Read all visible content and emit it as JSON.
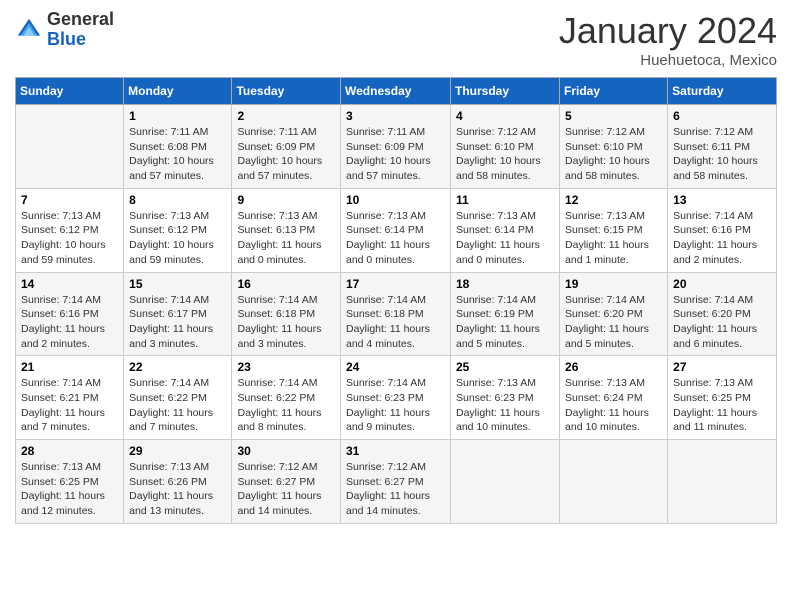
{
  "header": {
    "logo_line1": "General",
    "logo_line2": "Blue",
    "month_title": "January 2024",
    "location": "Huehuetoca, Mexico"
  },
  "days_of_week": [
    "Sunday",
    "Monday",
    "Tuesday",
    "Wednesday",
    "Thursday",
    "Friday",
    "Saturday"
  ],
  "weeks": [
    [
      {
        "day": "",
        "info": ""
      },
      {
        "day": "1",
        "info": "Sunrise: 7:11 AM\nSunset: 6:08 PM\nDaylight: 10 hours\nand 57 minutes."
      },
      {
        "day": "2",
        "info": "Sunrise: 7:11 AM\nSunset: 6:09 PM\nDaylight: 10 hours\nand 57 minutes."
      },
      {
        "day": "3",
        "info": "Sunrise: 7:11 AM\nSunset: 6:09 PM\nDaylight: 10 hours\nand 57 minutes."
      },
      {
        "day": "4",
        "info": "Sunrise: 7:12 AM\nSunset: 6:10 PM\nDaylight: 10 hours\nand 58 minutes."
      },
      {
        "day": "5",
        "info": "Sunrise: 7:12 AM\nSunset: 6:10 PM\nDaylight: 10 hours\nand 58 minutes."
      },
      {
        "day": "6",
        "info": "Sunrise: 7:12 AM\nSunset: 6:11 PM\nDaylight: 10 hours\nand 58 minutes."
      }
    ],
    [
      {
        "day": "7",
        "info": "Sunrise: 7:13 AM\nSunset: 6:12 PM\nDaylight: 10 hours\nand 59 minutes."
      },
      {
        "day": "8",
        "info": "Sunrise: 7:13 AM\nSunset: 6:12 PM\nDaylight: 10 hours\nand 59 minutes."
      },
      {
        "day": "9",
        "info": "Sunrise: 7:13 AM\nSunset: 6:13 PM\nDaylight: 11 hours\nand 0 minutes."
      },
      {
        "day": "10",
        "info": "Sunrise: 7:13 AM\nSunset: 6:14 PM\nDaylight: 11 hours\nand 0 minutes."
      },
      {
        "day": "11",
        "info": "Sunrise: 7:13 AM\nSunset: 6:14 PM\nDaylight: 11 hours\nand 0 minutes."
      },
      {
        "day": "12",
        "info": "Sunrise: 7:13 AM\nSunset: 6:15 PM\nDaylight: 11 hours\nand 1 minute."
      },
      {
        "day": "13",
        "info": "Sunrise: 7:14 AM\nSunset: 6:16 PM\nDaylight: 11 hours\nand 2 minutes."
      }
    ],
    [
      {
        "day": "14",
        "info": "Sunrise: 7:14 AM\nSunset: 6:16 PM\nDaylight: 11 hours\nand 2 minutes."
      },
      {
        "day": "15",
        "info": "Sunrise: 7:14 AM\nSunset: 6:17 PM\nDaylight: 11 hours\nand 3 minutes."
      },
      {
        "day": "16",
        "info": "Sunrise: 7:14 AM\nSunset: 6:18 PM\nDaylight: 11 hours\nand 3 minutes."
      },
      {
        "day": "17",
        "info": "Sunrise: 7:14 AM\nSunset: 6:18 PM\nDaylight: 11 hours\nand 4 minutes."
      },
      {
        "day": "18",
        "info": "Sunrise: 7:14 AM\nSunset: 6:19 PM\nDaylight: 11 hours\nand 5 minutes."
      },
      {
        "day": "19",
        "info": "Sunrise: 7:14 AM\nSunset: 6:20 PM\nDaylight: 11 hours\nand 5 minutes."
      },
      {
        "day": "20",
        "info": "Sunrise: 7:14 AM\nSunset: 6:20 PM\nDaylight: 11 hours\nand 6 minutes."
      }
    ],
    [
      {
        "day": "21",
        "info": "Sunrise: 7:14 AM\nSunset: 6:21 PM\nDaylight: 11 hours\nand 7 minutes."
      },
      {
        "day": "22",
        "info": "Sunrise: 7:14 AM\nSunset: 6:22 PM\nDaylight: 11 hours\nand 7 minutes."
      },
      {
        "day": "23",
        "info": "Sunrise: 7:14 AM\nSunset: 6:22 PM\nDaylight: 11 hours\nand 8 minutes."
      },
      {
        "day": "24",
        "info": "Sunrise: 7:14 AM\nSunset: 6:23 PM\nDaylight: 11 hours\nand 9 minutes."
      },
      {
        "day": "25",
        "info": "Sunrise: 7:13 AM\nSunset: 6:23 PM\nDaylight: 11 hours\nand 10 minutes."
      },
      {
        "day": "26",
        "info": "Sunrise: 7:13 AM\nSunset: 6:24 PM\nDaylight: 11 hours\nand 10 minutes."
      },
      {
        "day": "27",
        "info": "Sunrise: 7:13 AM\nSunset: 6:25 PM\nDaylight: 11 hours\nand 11 minutes."
      }
    ],
    [
      {
        "day": "28",
        "info": "Sunrise: 7:13 AM\nSunset: 6:25 PM\nDaylight: 11 hours\nand 12 minutes."
      },
      {
        "day": "29",
        "info": "Sunrise: 7:13 AM\nSunset: 6:26 PM\nDaylight: 11 hours\nand 13 minutes."
      },
      {
        "day": "30",
        "info": "Sunrise: 7:12 AM\nSunset: 6:27 PM\nDaylight: 11 hours\nand 14 minutes."
      },
      {
        "day": "31",
        "info": "Sunrise: 7:12 AM\nSunset: 6:27 PM\nDaylight: 11 hours\nand 14 minutes."
      },
      {
        "day": "",
        "info": ""
      },
      {
        "day": "",
        "info": ""
      },
      {
        "day": "",
        "info": ""
      }
    ]
  ]
}
